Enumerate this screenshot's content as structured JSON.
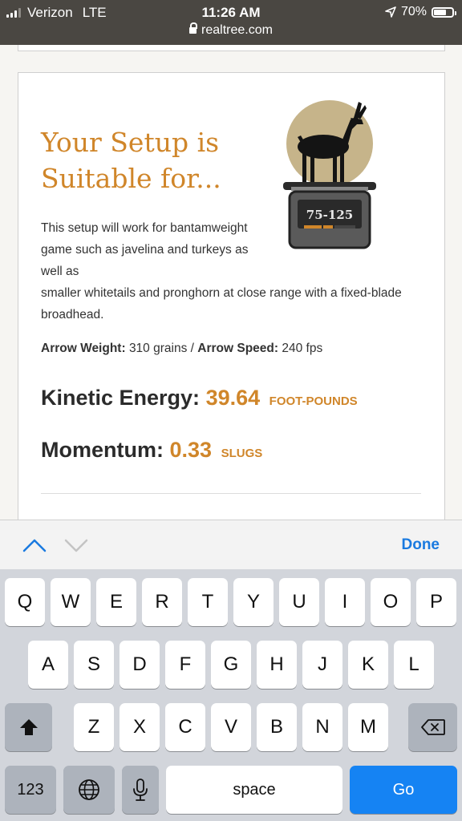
{
  "status_bar": {
    "carrier": "Verizon",
    "network": "LTE",
    "time": "11:26 AM",
    "url": "realtree.com",
    "battery": "70%",
    "battery_level": 0.7
  },
  "card": {
    "headline_line1": "Your Setup is",
    "headline_line2": "Suitable for...",
    "scale_label": "75-125",
    "description_narrow": "This setup will work for bantamweight game such as javelina and turkeys as well as",
    "description_wide": "smaller whitetails and pronghorn at close range with a fixed-blade broadhead.",
    "arrow_weight_label": "Arrow Weight:",
    "arrow_weight_value": "310 grains",
    "separator": "/",
    "arrow_speed_label": "Arrow Speed:",
    "arrow_speed_value": "240 fps",
    "kinetic_energy_label": "Kinetic Energy:",
    "kinetic_energy_value": "39.64",
    "kinetic_energy_unit": "FOOT-POUNDS",
    "momentum_label": "Momentum:",
    "momentum_value": "0.33",
    "momentum_unit": "SLUGS"
  },
  "accessory_bar": {
    "done_label": "Done"
  },
  "keyboard": {
    "row1": [
      "Q",
      "W",
      "E",
      "R",
      "T",
      "Y",
      "U",
      "I",
      "O",
      "P"
    ],
    "row2": [
      "A",
      "S",
      "D",
      "F",
      "G",
      "H",
      "J",
      "K",
      "L"
    ],
    "row3": [
      "Z",
      "X",
      "C",
      "V",
      "B",
      "N",
      "M"
    ],
    "numbers_label": "123",
    "space_label": "space",
    "go_label": "Go"
  },
  "colors": {
    "accent_orange": "#d0862a",
    "done_blue": "#1a7ae0",
    "go_blue": "#1583f3",
    "status_bar_bg": "#4a4742"
  }
}
